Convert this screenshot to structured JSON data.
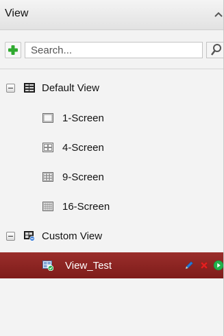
{
  "panel": {
    "title": "View",
    "collapse_icon": "chevron-up-icon"
  },
  "toolbar": {
    "add_icon": "plus-icon",
    "search_placeholder": "Search...",
    "search_icon": "search-icon"
  },
  "tree": {
    "default_view": {
      "label": "Default View",
      "icon": "view-group-icon",
      "expanded": true,
      "children": [
        {
          "label": "1-Screen",
          "icon": "1-screen-layout-icon"
        },
        {
          "label": "4-Screen",
          "icon": "4-screen-layout-icon"
        },
        {
          "label": "9-Screen",
          "icon": "9-screen-layout-icon"
        },
        {
          "label": "16-Screen",
          "icon": "16-screen-layout-icon"
        }
      ]
    },
    "custom_view": {
      "label": "Custom View",
      "icon": "custom-view-group-icon",
      "expanded": true,
      "children": [
        {
          "label": "View_Test",
          "icon": "view-item-icon",
          "selected": true,
          "actions": [
            "edit-icon",
            "delete-icon",
            "play-icon"
          ]
        }
      ]
    }
  },
  "colors": {
    "selected_row": "#8b2422",
    "add_green": "#2faa2f",
    "delete_red": "#e02020",
    "edit_blue": "#2a78d6",
    "play_green": "#22b14c"
  }
}
